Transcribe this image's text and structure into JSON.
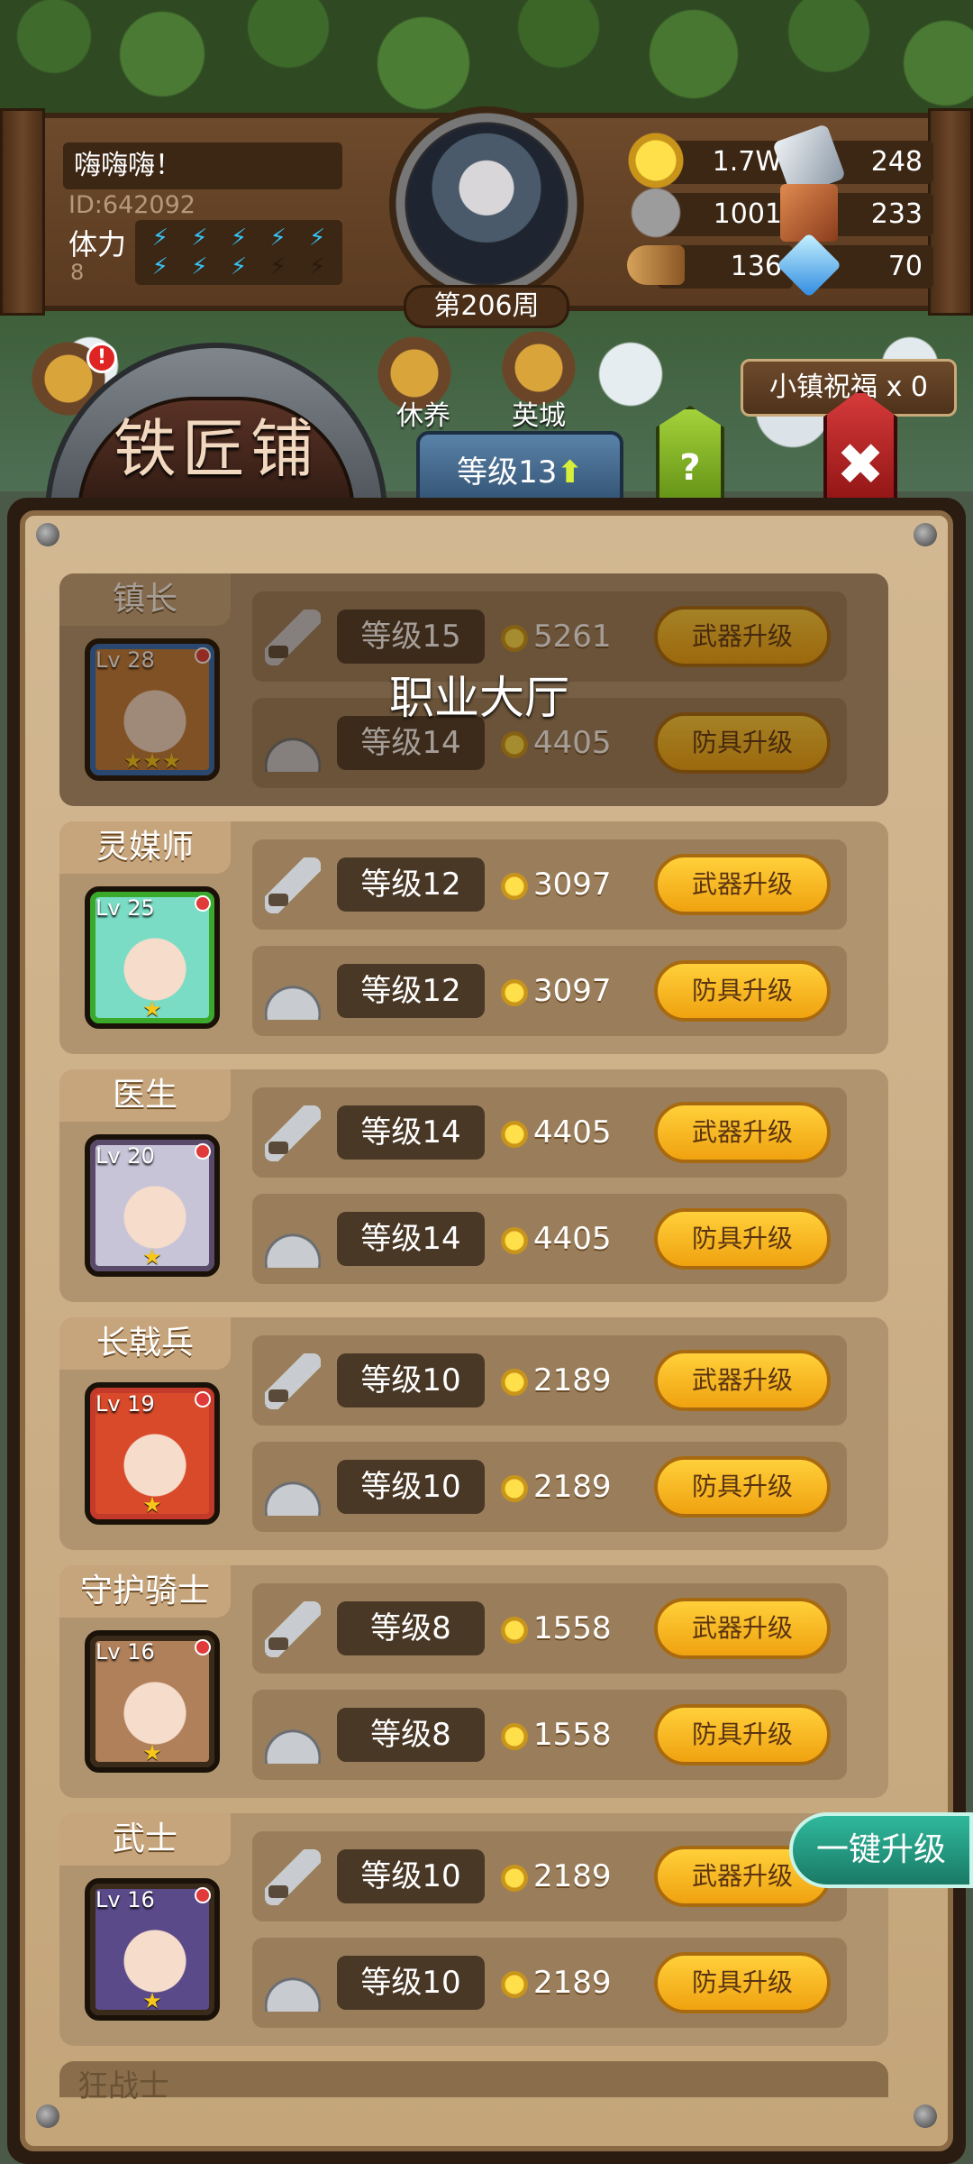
{
  "player": {
    "name": "嗨嗨嗨！",
    "id": "ID:642092",
    "stamina_label": "体力",
    "stamina_value": "8",
    "stamina_full": 8,
    "stamina_max": 10,
    "week": "第206周"
  },
  "resources": {
    "gold": "1.7W",
    "iron": "248",
    "stone": "1001",
    "cloth": "233",
    "wood": "136",
    "crystal": "70"
  },
  "shortcuts": {
    "alert": "!",
    "rest": "休养",
    "city": "英城"
  },
  "blessing": "小镇祝福 x 0",
  "shop": {
    "title": "铁匠铺",
    "level": "等级13",
    "help": "?",
    "close": "✖"
  },
  "overlay_label": "职业大厅",
  "one_key_upgrade": "一键升级",
  "heroes": [
    {
      "role": "镇长",
      "lv": "Lv 28",
      "stars": "★★★",
      "frame": "#2a6ab8",
      "weapon_level": "等级15",
      "weapon_cost": "5261",
      "armor_level": "等级14",
      "armor_cost": "4405",
      "dim": true
    },
    {
      "role": "灵媒师",
      "lv": "Lv 25",
      "stars": "★",
      "frame": "#3aa82a",
      "weapon_level": "等级12",
      "weapon_cost": "3097",
      "armor_level": "等级12",
      "armor_cost": "3097",
      "dim": false
    },
    {
      "role": "医生",
      "lv": "Lv 20",
      "stars": "★",
      "frame": "#5a4a6a",
      "weapon_level": "等级14",
      "weapon_cost": "4405",
      "armor_level": "等级14",
      "armor_cost": "4405",
      "dim": false
    },
    {
      "role": "长戟兵",
      "lv": "Lv 19",
      "stars": "★",
      "frame": "#c43a2a",
      "weapon_level": "等级10",
      "weapon_cost": "2189",
      "armor_level": "等级10",
      "armor_cost": "2189",
      "dim": false
    },
    {
      "role": "守护骑士",
      "lv": "Lv 16",
      "stars": "★",
      "frame": "#3a2a1a",
      "weapon_level": "等级8",
      "weapon_cost": "1558",
      "armor_level": "等级8",
      "armor_cost": "1558",
      "dim": false
    },
    {
      "role": "武士",
      "lv": "Lv 16",
      "stars": "★",
      "frame": "#3a2a1a",
      "weapon_level": "等级10",
      "weapon_cost": "2189",
      "armor_level": "等级10",
      "armor_cost": "2189",
      "dim": false
    }
  ],
  "weapon_btn": "武器升级",
  "armor_btn": "防具升级",
  "next_role_partial": "狂战士"
}
